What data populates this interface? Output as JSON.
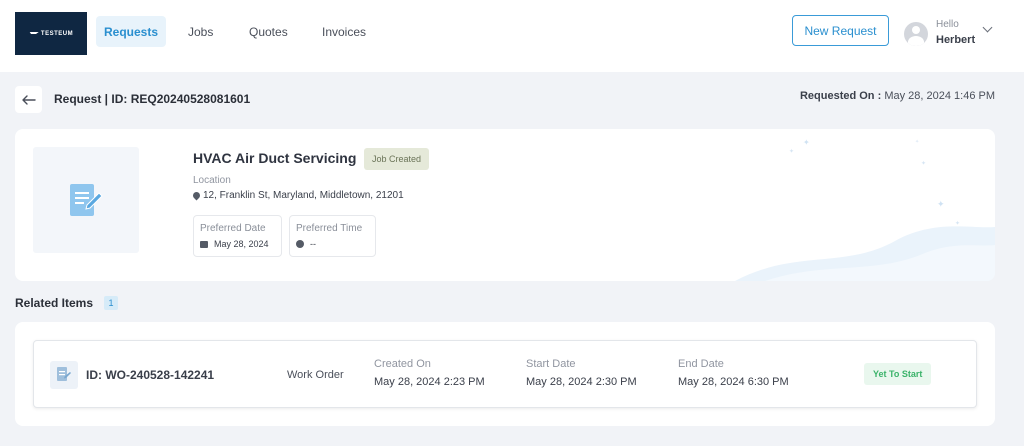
{
  "brand": {
    "logo_text": "TESTEUM",
    "logo_bg": "#0f2742"
  },
  "nav": [
    {
      "label": "Requests",
      "active": true
    },
    {
      "label": "Jobs",
      "active": false
    },
    {
      "label": "Quotes",
      "active": false
    },
    {
      "label": "Invoices",
      "active": false
    }
  ],
  "header_actions": {
    "new_request_label": "New Request"
  },
  "user": {
    "greeting": "Hello",
    "name": "Herbert"
  },
  "page": {
    "title": "Request | ID: REQ20240528081601",
    "requested_on_label": "Requested On :",
    "requested_on_value": "May 28, 2024 1:46 PM"
  },
  "request": {
    "service_name": "HVAC Air Duct Servicing",
    "status": "Job Created",
    "location_label": "Location",
    "location": "12, Franklin St, Maryland, Middletown, 21201",
    "preferred_date_label": "Preferred Date",
    "preferred_date": "May 28, 2024",
    "preferred_time_label": "Preferred Time",
    "preferred_time": "--"
  },
  "related": {
    "title": "Related Items",
    "count": "1",
    "items": [
      {
        "id": "ID: WO-240528-142241",
        "type": "Work Order",
        "created_label": "Created On",
        "created_value": "May 28, 2024 2:23 PM",
        "start_label": "Start Date",
        "start_value": "May 28, 2024 2:30 PM",
        "end_label": "End Date",
        "end_value": "May 28, 2024 6:30 PM",
        "status": "Yet To Start"
      }
    ]
  },
  "colors": {
    "accent": "#2a8fcf",
    "status_job_created_bg": "#e5e9d9",
    "status_yet_to_start": "#3bb36a",
    "page_bg": "#f1f3f7"
  },
  "icons": {
    "back": "arrow-left-icon",
    "doc": "document-edit-icon",
    "location": "map-pin-icon",
    "calendar": "calendar-icon",
    "clock": "clock-icon",
    "chevron": "chevron-down-icon"
  }
}
